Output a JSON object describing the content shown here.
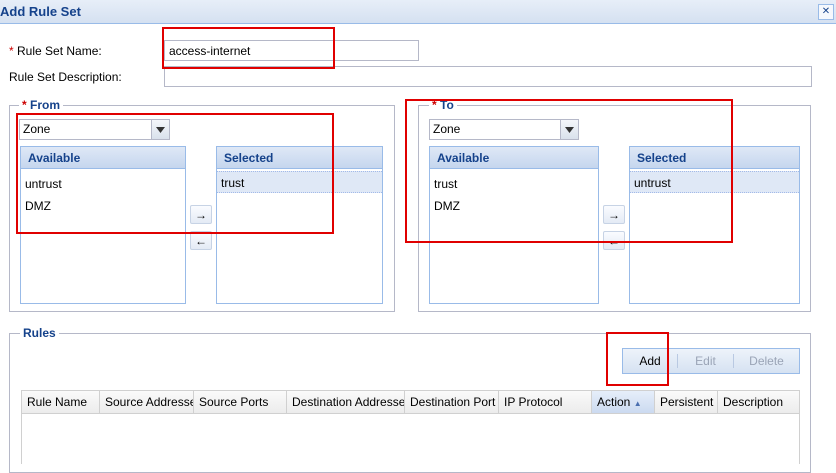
{
  "window": {
    "title": "Add Rule Set",
    "close_glyph": "✕"
  },
  "form": {
    "name_label": "Rule Set Name:",
    "name_value": "access-internet",
    "desc_label": "Rule Set Description:",
    "desc_value": "",
    "required_mark": "*"
  },
  "from": {
    "legend": "From",
    "type": "Zone",
    "available_header": "Available",
    "selected_header": "Selected",
    "available": [
      "untrust",
      "DMZ"
    ],
    "selected": [
      "trust"
    ]
  },
  "to": {
    "legend": "To",
    "type": "Zone",
    "available_header": "Available",
    "selected_header": "Selected",
    "available": [
      "trust",
      "DMZ"
    ],
    "selected": [
      "untrust"
    ]
  },
  "rules": {
    "legend": "Rules",
    "toolbar": {
      "add": "Add",
      "edit": "Edit",
      "delete": "Delete"
    },
    "columns": [
      "Rule Name",
      "Source Addresse",
      "Source Ports",
      "Destination Addresse",
      "Destination Port",
      "IP Protocol",
      "Action",
      "Persistent",
      "Description"
    ],
    "sorted_column": "Action"
  },
  "icons": {
    "move_right": "→",
    "move_left": "←",
    "sort_asc": "▲"
  },
  "colors": {
    "accent": "#15428b",
    "highlight": "#e00000",
    "border": "#99bbe8"
  }
}
